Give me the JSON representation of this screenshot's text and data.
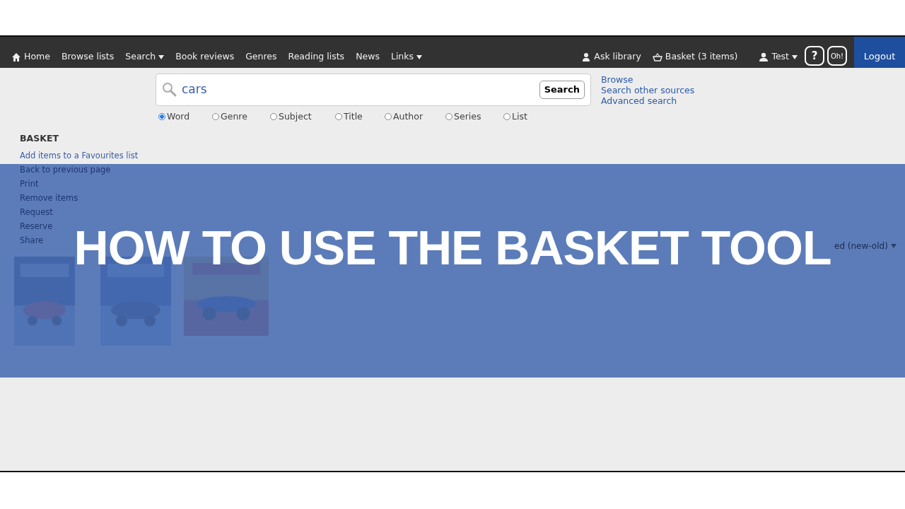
{
  "navbar": {
    "items": [
      {
        "label": "Home",
        "kind": "home",
        "dropdown": false
      },
      {
        "label": "Browse lists",
        "kind": "plain",
        "dropdown": false
      },
      {
        "label": "Search",
        "kind": "plain",
        "dropdown": true
      },
      {
        "label": "Book reviews",
        "kind": "plain",
        "dropdown": false
      },
      {
        "label": "Genres",
        "kind": "plain",
        "dropdown": false
      },
      {
        "label": "Reading lists",
        "kind": "plain",
        "dropdown": false
      },
      {
        "label": "News",
        "kind": "plain",
        "dropdown": false
      },
      {
        "label": "Links",
        "kind": "plain",
        "dropdown": true
      }
    ],
    "right": [
      {
        "label": "Ask library",
        "kind": "ask",
        "dropdown": false
      },
      {
        "label": "Basket (3 items)",
        "kind": "basket",
        "dropdown": false
      },
      {
        "label": "Test",
        "kind": "user",
        "dropdown": true
      }
    ],
    "round_buttons": [
      "?",
      "Oh!"
    ],
    "logout": "Logout"
  },
  "search": {
    "value": "cars",
    "button": "Search",
    "links": [
      "Browse",
      "Search other sources",
      "Advanced search"
    ],
    "options": [
      {
        "label": "Word",
        "selected": true
      },
      {
        "label": "Genre",
        "selected": false
      },
      {
        "label": "Subject",
        "selected": false
      },
      {
        "label": "Title",
        "selected": false
      },
      {
        "label": "Author",
        "selected": false
      },
      {
        "label": "Series",
        "selected": false
      },
      {
        "label": "List",
        "selected": false
      }
    ]
  },
  "sidebar": {
    "heading": "BASKET",
    "items": [
      "Add items to a Favourites list",
      "Back to previous page",
      "Print",
      "Remove items",
      "Request",
      "Reserve",
      "Share"
    ]
  },
  "sort": "ed (new-old)",
  "banner": {
    "title": "HOW TO USE THE BASKET TOOL"
  }
}
